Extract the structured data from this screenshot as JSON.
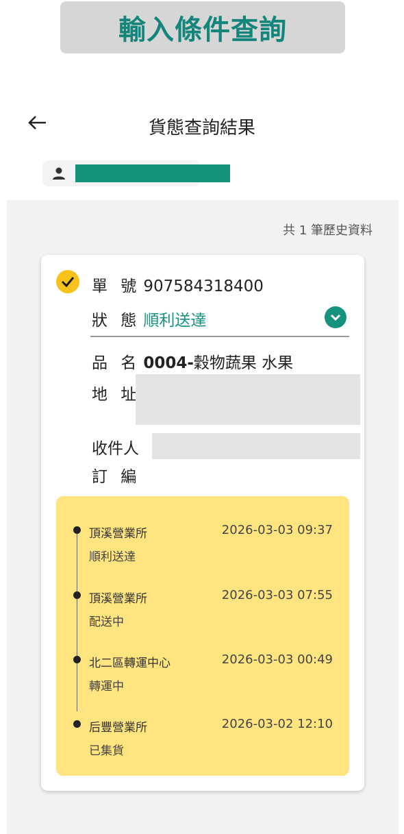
{
  "banner": {
    "text": "輸入條件查詢"
  },
  "header": {
    "title": "貨態查詢結果"
  },
  "record_count": "共 1 筆歷史資料",
  "card": {
    "order_no_label": "單 號",
    "order_no": "907584318400",
    "status_label": "狀 態",
    "status": "順利送達",
    "product_label": "品 名",
    "product_code": "0004-",
    "product_name": "穀物蔬果 水果",
    "address_label": "地 址",
    "recipient_label": "收件人",
    "order_ref_label": "訂 編"
  },
  "timeline": [
    {
      "location": "頂溪營業所",
      "status": "順利送達",
      "time": "2026-03-03 09:37"
    },
    {
      "location": "頂溪營業所",
      "status": "配送中",
      "time": "2026-03-03 07:55"
    },
    {
      "location": "北二區轉運中心",
      "status": "轉運中",
      "time": "2026-03-03 00:49"
    },
    {
      "location": "后豐營業所",
      "status": "已集貨",
      "time": "2026-03-02 12:10"
    }
  ],
  "colors": {
    "accent": "#16927f",
    "banner_text": "#14857a",
    "check_badge": "#f7c21b",
    "timeline_bg": "#ffe480"
  },
  "icons": [
    "back-arrow-icon",
    "user-icon",
    "check-icon",
    "chevron-down-icon"
  ]
}
